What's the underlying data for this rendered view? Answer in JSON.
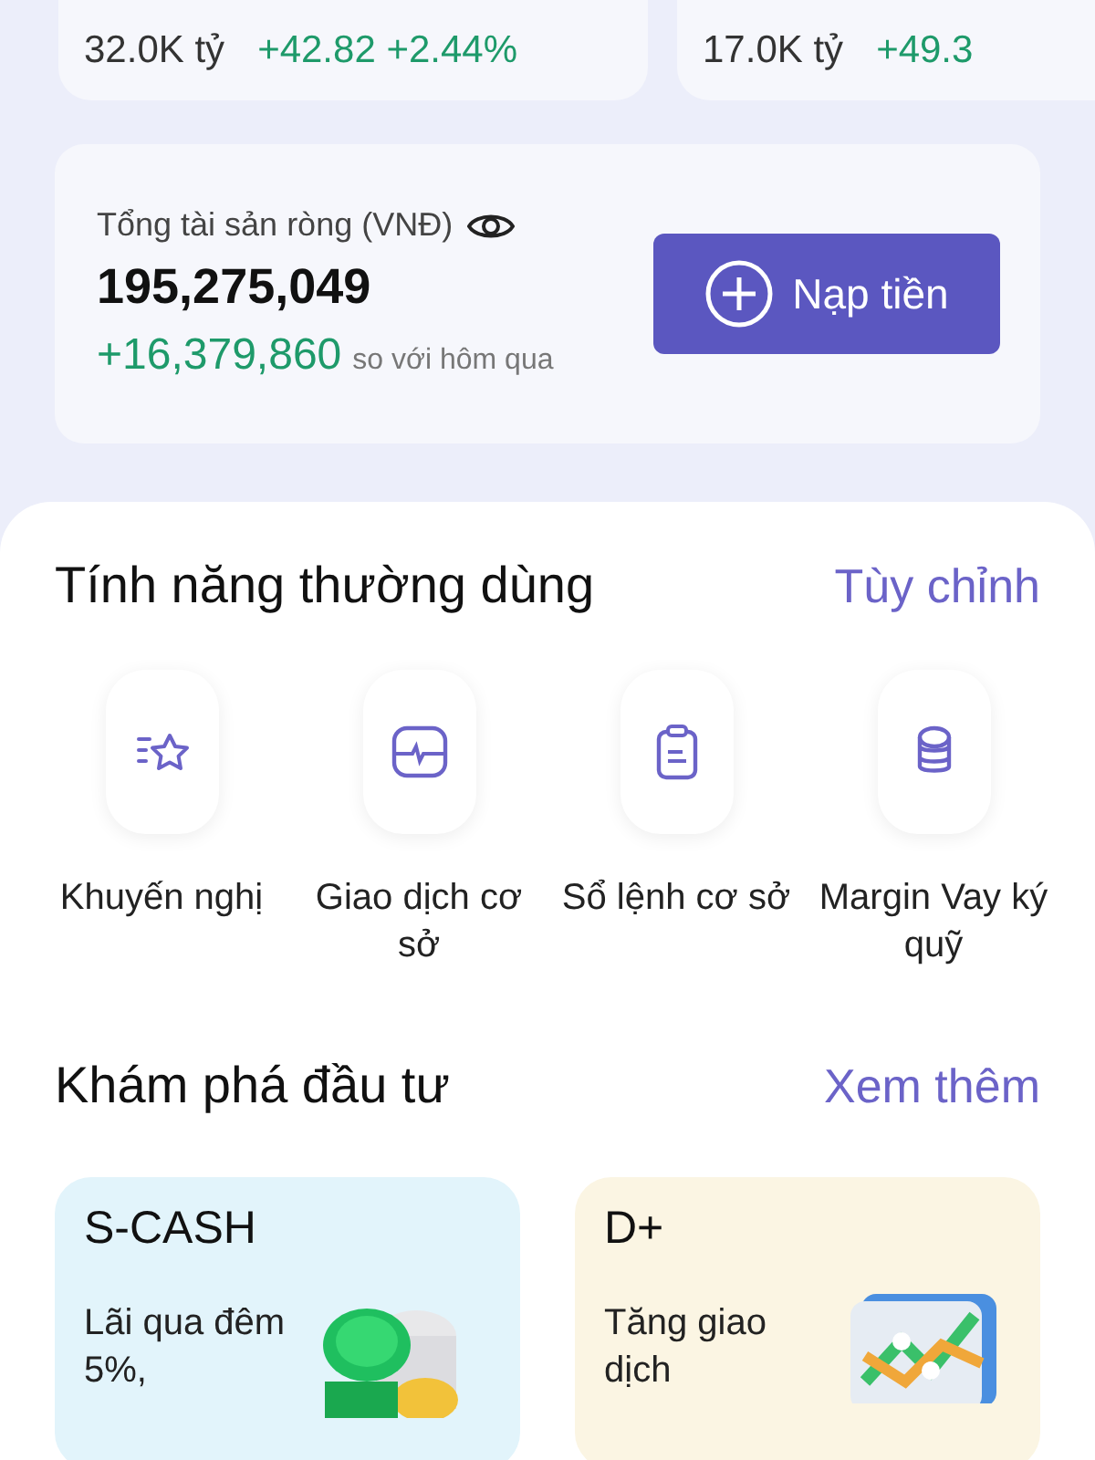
{
  "market_cards": [
    {
      "value": "32.0K tỷ",
      "change": "+42.82",
      "percent": "+2.44%"
    },
    {
      "value": "17.0K tỷ",
      "change": "+49.3"
    }
  ],
  "assets": {
    "label": "Tổng tài sản ròng (VNĐ)",
    "total": "195,275,049",
    "change": "+16,379,860",
    "change_note": "so với hôm qua",
    "button": "Nạp tiền"
  },
  "features": {
    "title": "Tính năng thường dùng",
    "action": "Tùy chỉnh",
    "items": [
      {
        "kind": "star",
        "label": "Khuyến nghị"
      },
      {
        "kind": "pulse",
        "label": "Giao dịch cơ sở"
      },
      {
        "kind": "clipboard",
        "label": "Sổ lệnh cơ sở"
      },
      {
        "kind": "coins",
        "label": "Margin Vay ký quỹ"
      }
    ]
  },
  "explore": {
    "title": "Khám phá đầu tư",
    "action": "Xem thêm",
    "cards": [
      {
        "kind": "coins",
        "title": "S-CASH",
        "text": "Lãi qua đêm 5%,"
      },
      {
        "kind": "chart",
        "title": "D+",
        "text": "Tăng giao dịch"
      }
    ]
  }
}
